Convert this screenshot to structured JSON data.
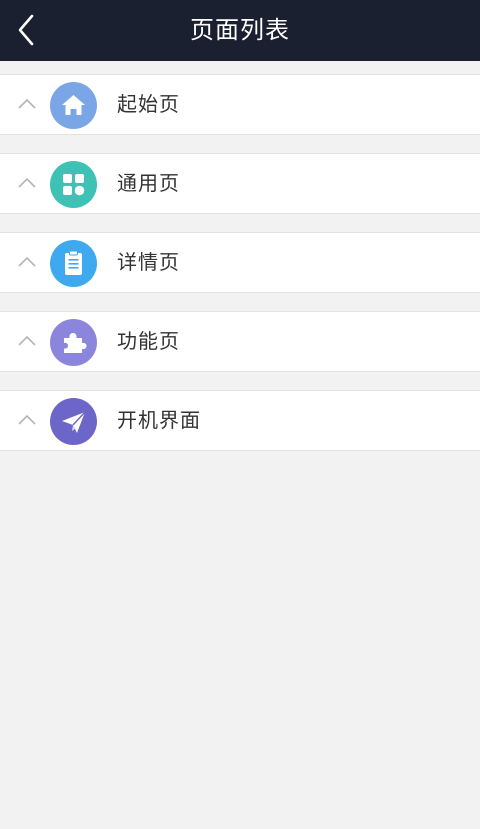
{
  "header": {
    "title": "页面列表",
    "back_icon": "chevron-left-icon"
  },
  "items": [
    {
      "label": "起始页",
      "icon": "home-icon",
      "color": "#7aa6e8"
    },
    {
      "label": "通用页",
      "icon": "grid-icon",
      "color": "#3ec2b5"
    },
    {
      "label": "详情页",
      "icon": "clipboard-icon",
      "color": "#3fa9f0"
    },
    {
      "label": "功能页",
      "icon": "puzzle-icon",
      "color": "#8b86db"
    },
    {
      "label": "开机界面",
      "icon": "paper-plane-icon",
      "color": "#6b66c8"
    }
  ],
  "colors": {
    "navbar_bg": "#1b2030",
    "page_bg": "#f2f2f2",
    "row_bg": "#ffffff"
  }
}
